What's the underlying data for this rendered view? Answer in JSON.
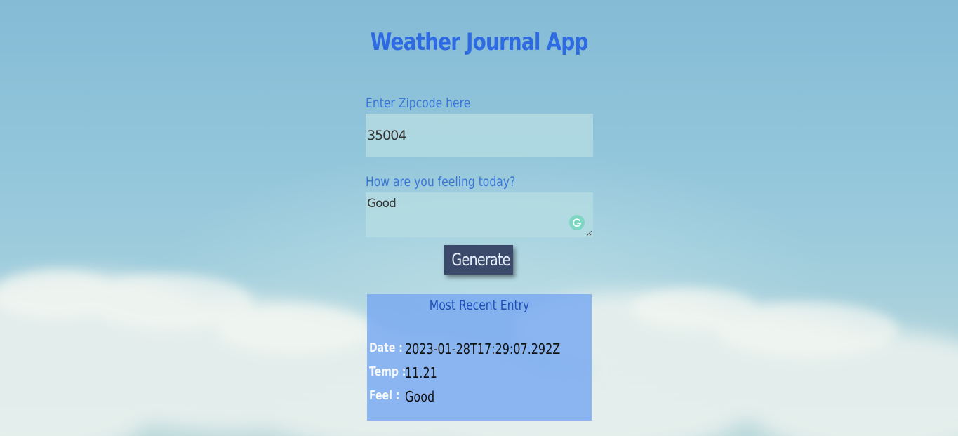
{
  "app": {
    "title": "Weather Journal App"
  },
  "form": {
    "zip_label": "Enter Zipcode here",
    "zip_value": "35004",
    "feelings_label": "How are you feeling today?",
    "feelings_value": "Good",
    "generate_label": "Generate"
  },
  "entry": {
    "title": "Most Recent Entry",
    "date_label": "Date :",
    "date_value": "2023-01-28T17:29:07.292Z",
    "temp_label": "Temp :",
    "temp_value": "11.21",
    "feel_label": "Feel :",
    "feel_value": "Good"
  },
  "colors": {
    "accent": "#2e6be3",
    "button_bg": "#3b4a6a",
    "entry_bg": "#78a8f0"
  },
  "icons": {
    "grammar_checker": "grammarly-icon",
    "resize": "resize-handle-icon"
  }
}
